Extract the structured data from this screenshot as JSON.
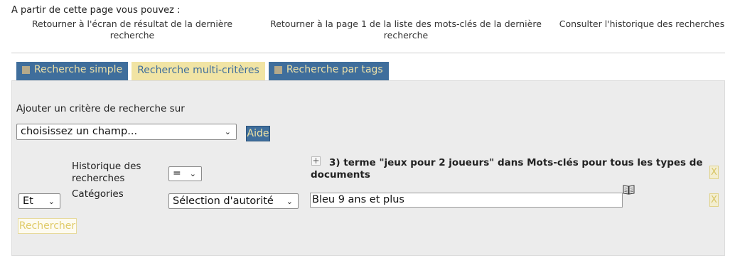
{
  "intro": "A partir de cette page vous pouvez :",
  "nav_links": [
    "Retourner à l'écran de résultat de la dernière recherche",
    "Retourner à la page 1 de la liste des mots-clés de la dernière recherche",
    "Consulter l'historique des recherches"
  ],
  "tabs": [
    {
      "label": "Recherche simple"
    },
    {
      "label": "Recherche multi-critères"
    },
    {
      "label": "Recherche par tags"
    }
  ],
  "form": {
    "add_criterion_label": "Ajouter un critère de recherche sur",
    "field_select_value": "choisissez un champ...",
    "help_label": "Aide",
    "criteria": [
      {
        "label": "Historique des recherches",
        "operator": "=",
        "term": "3) terme \"jeux pour 2 joueurs\" dans Mots-clés pour tous les types de documents",
        "remove": "X"
      },
      {
        "connector": "Et",
        "label": "Catégories",
        "operator": "Sélection d'autorité",
        "value": "Bleu 9 ans et plus",
        "remove": "X"
      }
    ],
    "search_button": "Rechercher"
  },
  "colors": {
    "tab_blue": "#3f6e9c",
    "tab_active": "#f1e4a4",
    "panel": "#ececec"
  }
}
